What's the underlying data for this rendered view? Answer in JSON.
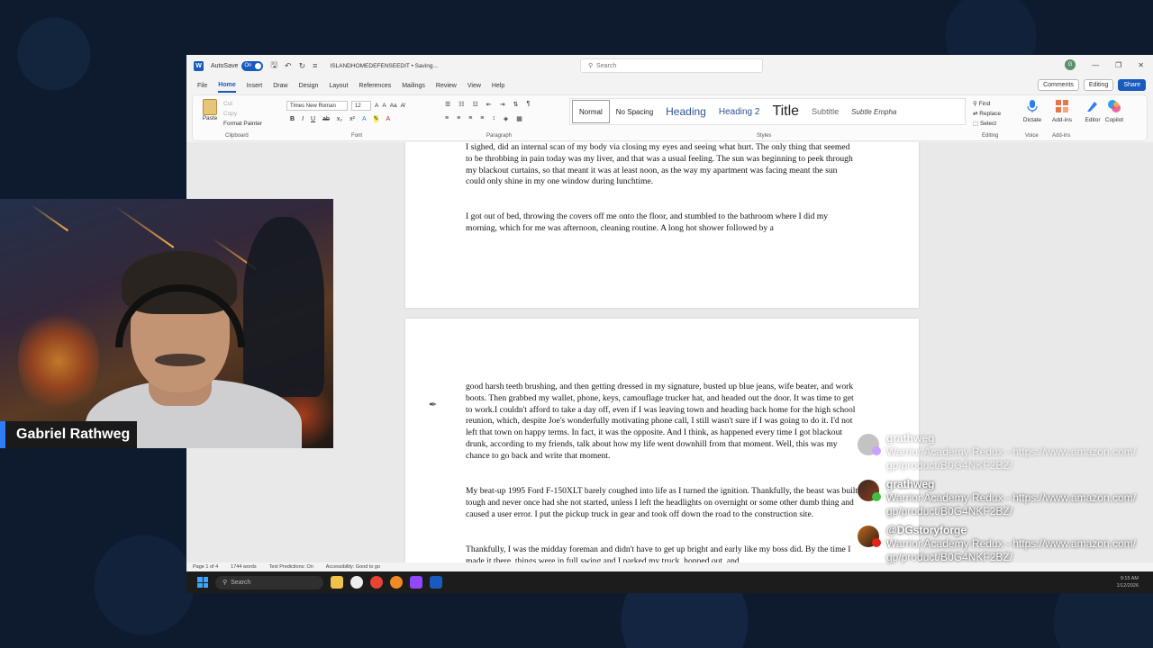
{
  "word": {
    "autosave_label": "AutoSave",
    "autosave_state": "On",
    "doc_title": "ISLANDHOMEDEFENSEEDIT • Saving...",
    "search_placeholder": "Search",
    "user_initial": "G",
    "menu": [
      "File",
      "Home",
      "Insert",
      "Draw",
      "Design",
      "Layout",
      "References",
      "Mailings",
      "Review",
      "View",
      "Help"
    ],
    "comments_label": "Comments",
    "editing_label": "Editing",
    "share_label": "Share",
    "ribbon": {
      "paste_label": "Paste",
      "cut_label": "Cut",
      "copy_label": "Copy",
      "format_painter_label": "Format Painter",
      "clipboard_label": "Clipboard",
      "font_name": "Times New Roman",
      "font_size": "12",
      "font_label": "Font",
      "paragraph_label": "Paragraph",
      "styles_label": "Styles",
      "styles": [
        "Normal",
        "No Spacing",
        "Heading",
        "Heading 2",
        "Title",
        "Subtitle",
        "Subtle Empha"
      ],
      "find_label": "Find",
      "replace_label": "Replace",
      "select_label": "Select",
      "editing_group_label": "Editing",
      "dictate_label": "Dictate",
      "voice_label": "Voice",
      "addins_label": "Add-ins",
      "addins_group_label": "Add-ins",
      "editor_label": "Editor",
      "copilot_label": "Copilot"
    },
    "page1": {
      "p1": "I sighed, did an internal scan of my body via closing my eyes and seeing what hurt. The only thing that seemed to be throbbing in pain today was my liver, and that was a usual feeling. The sun was beginning to peek through my blackout curtains, so that meant it was at least noon, as the way my apartment was facing meant the sun could only shine in my one window during lunchtime.",
      "p2": "I got out of bed, throwing the covers off me onto the floor, and stumbled to the bathroom where I did my morning, which for me was afternoon, cleaning routine. A long hot shower followed by a"
    },
    "page2": {
      "p1": "good harsh teeth brushing, and then getting dressed in my signature, busted up blue jeans, wife beater, and work boots. Then grabbed my wallet, phone, keys, camouflage trucker hat, and headed out the door. It was time to get to work.I couldn't afford to take a day off, even if I was leaving town and heading back home for the high school reunion, which, despite Joe's wonderfully motivating phone call, I still wasn't sure if I was going to do it. I'd not left that town on happy terms. In fact, it was the opposite. And I think, as happened every time I got blackout drunk, according to my friends, talk about how my life went downhill from that moment. Well, this was my chance to go back and write that moment.",
      "p2": "My beat-up 1995 Ford F-150XLT barely coughed into life as I turned the ignition. Thankfully, the beast was built tough and never once had she not started, unless I left the headlights on overnight or some other dumb thing and caused a user error. I put the pickup truck in gear and took off down the road to the construction site.",
      "p3": "Thankfully, I was the midday foreman and didn't have to get up bright and early like my boss did. By the time I made it there, things were in full swing and I parked my truck, hopped out, and"
    },
    "status": {
      "page": "Page 1 of 4",
      "words": "1744 words",
      "predictions": "Text Predictions: On",
      "accessibility": "Accessibility: Good to go"
    }
  },
  "taskbar": {
    "search_placeholder": "Search",
    "time": "9:15 AM",
    "date": "1/12/2026"
  },
  "webcam": {
    "name": "Gabriel Rathweg"
  },
  "chat": [
    {
      "user": "grathweg",
      "text": "Warrior Academy Redux - https://www.amazon.com/gp/product/B0G4NKF2BZ/",
      "faded": true
    },
    {
      "user": "grathweg",
      "text": "Warrior Academy Redux - https://www.amazon.com/gp/product/B0G4NKF2BZ/",
      "faded": false
    },
    {
      "user": "@DGstoryforge",
      "text": "Warrior Academy Redux - https://www.amazon.com/gp/product/B0G4NKF2BZ/",
      "faded": false
    }
  ]
}
